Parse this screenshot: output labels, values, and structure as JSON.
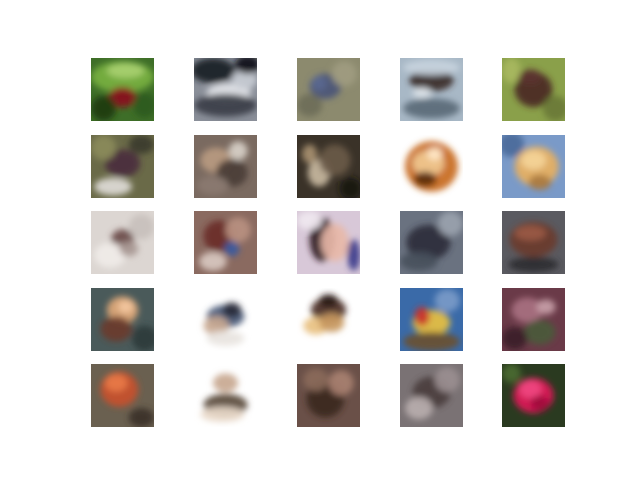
{
  "figure": {
    "background": "#ffffff",
    "rows": 5,
    "cols": 5
  },
  "tiles": [
    {
      "label": "sample-r1-c1",
      "bg": "#3e6e28",
      "blobs": [
        [
          "#78b040",
          0.5,
          0.3,
          0.5,
          0.25
        ],
        [
          "#a8d070",
          0.55,
          0.2,
          0.3,
          0.12
        ],
        [
          "#8a1020",
          0.5,
          0.62,
          0.22,
          0.16
        ],
        [
          "#1e3a12",
          0.2,
          0.8,
          0.2,
          0.2
        ],
        [
          "#2c5a1c",
          0.85,
          0.75,
          0.18,
          0.2
        ]
      ]
    },
    {
      "label": "sample-r1-c2",
      "bg": "#8a8f99",
      "blobs": [
        [
          "#1a1c22",
          0.3,
          0.2,
          0.35,
          0.2
        ],
        [
          "#e4e6ea",
          0.55,
          0.55,
          0.35,
          0.15
        ],
        [
          "#3a3e48",
          0.5,
          0.75,
          0.5,
          0.18
        ],
        [
          "#c8ccd4",
          0.8,
          0.35,
          0.2,
          0.15
        ],
        [
          "#0e1014",
          0.85,
          0.1,
          0.2,
          0.15
        ]
      ]
    },
    {
      "label": "sample-r1-c3",
      "bg": "#8c8a6e",
      "blobs": [
        [
          "#4a5478",
          0.45,
          0.45,
          0.25,
          0.2
        ],
        [
          "#5a6890",
          0.35,
          0.4,
          0.12,
          0.12
        ],
        [
          "#a09c80",
          0.75,
          0.25,
          0.2,
          0.2
        ],
        [
          "#6e6c58",
          0.2,
          0.75,
          0.2,
          0.18
        ]
      ]
    },
    {
      "label": "sample-r1-c4",
      "bg": "#a8b8c6",
      "blobs": [
        [
          "#3a2a28",
          0.5,
          0.35,
          0.35,
          0.18
        ],
        [
          "#c8d4de",
          0.5,
          0.15,
          0.45,
          0.12
        ],
        [
          "#5a6a78",
          0.5,
          0.8,
          0.45,
          0.16
        ],
        [
          "#e0e6ec",
          0.35,
          0.55,
          0.15,
          0.08
        ]
      ]
    },
    {
      "label": "sample-r1-c5",
      "bg": "#8aa04a",
      "blobs": [
        [
          "#4a2824",
          0.5,
          0.5,
          0.3,
          0.28
        ],
        [
          "#a8b860",
          0.15,
          0.2,
          0.15,
          0.2
        ],
        [
          "#6a7a38",
          0.85,
          0.8,
          0.2,
          0.2
        ],
        [
          "#5c3430",
          0.45,
          0.3,
          0.18,
          0.12
        ]
      ]
    },
    {
      "label": "sample-r2-c1",
      "bg": "#6a6a48",
      "blobs": [
        [
          "#4a2c3c",
          0.5,
          0.45,
          0.28,
          0.22
        ],
        [
          "#e0dcd8",
          0.35,
          0.82,
          0.3,
          0.14
        ],
        [
          "#8a8a5a",
          0.2,
          0.2,
          0.2,
          0.2
        ],
        [
          "#3a3a2a",
          0.8,
          0.15,
          0.2,
          0.15
        ]
      ]
    },
    {
      "label": "sample-r2-c2",
      "bg": "#7a6a60",
      "blobs": [
        [
          "#b89a80",
          0.35,
          0.4,
          0.25,
          0.2
        ],
        [
          "#4a3c36",
          0.6,
          0.6,
          0.25,
          0.22
        ],
        [
          "#d8d0c8",
          0.7,
          0.25,
          0.15,
          0.15
        ],
        [
          "#8a7a70",
          0.3,
          0.8,
          0.25,
          0.15
        ]
      ]
    },
    {
      "label": "sample-r2-c3",
      "bg": "#3a3228",
      "blobs": [
        [
          "#c8b8a0",
          0.35,
          0.6,
          0.18,
          0.22
        ],
        [
          "#6a5a48",
          0.6,
          0.4,
          0.25,
          0.25
        ],
        [
          "#1a1612",
          0.85,
          0.85,
          0.18,
          0.18
        ],
        [
          "#a89070",
          0.2,
          0.3,
          0.12,
          0.15
        ]
      ]
    },
    {
      "label": "sample-r2-c4",
      "bg": "#ffffff",
      "blobs": [
        [
          "#c86a20",
          0.5,
          0.5,
          0.42,
          0.4
        ],
        [
          "#f0c890",
          0.45,
          0.45,
          0.25,
          0.2
        ],
        [
          "#5a2c10",
          0.4,
          0.7,
          0.18,
          0.12
        ],
        [
          "#ffe8c8",
          0.55,
          0.3,
          0.12,
          0.1
        ]
      ]
    },
    {
      "label": "sample-r2-c5",
      "bg": "#7a9ac8",
      "blobs": [
        [
          "#e8b060",
          0.55,
          0.5,
          0.35,
          0.32
        ],
        [
          "#f4d498",
          0.5,
          0.4,
          0.2,
          0.15
        ],
        [
          "#4a6a9a",
          0.15,
          0.15,
          0.2,
          0.2
        ],
        [
          "#a87840",
          0.6,
          0.75,
          0.18,
          0.12
        ]
      ]
    },
    {
      "label": "sample-r3-c1",
      "bg": "#dcd6d2",
      "blobs": [
        [
          "#6a4a48",
          0.5,
          0.45,
          0.18,
          0.16
        ],
        [
          "#f0ece8",
          0.3,
          0.7,
          0.25,
          0.2
        ],
        [
          "#a89894",
          0.6,
          0.6,
          0.15,
          0.12
        ],
        [
          "#c8c0bc",
          0.8,
          0.25,
          0.2,
          0.2
        ]
      ]
    },
    {
      "label": "sample-r3-c2",
      "bg": "#8a6a60",
      "blobs": [
        [
          "#6a2c28",
          0.4,
          0.4,
          0.25,
          0.25
        ],
        [
          "#b89080",
          0.7,
          0.3,
          0.2,
          0.2
        ],
        [
          "#3a5aa0",
          0.6,
          0.6,
          0.12,
          0.12
        ],
        [
          "#d8c8c0",
          0.3,
          0.8,
          0.22,
          0.15
        ]
      ]
    },
    {
      "label": "sample-r3-c3",
      "bg": "#d8c8d8",
      "blobs": [
        [
          "#2a1a20",
          0.4,
          0.45,
          0.2,
          0.35
        ],
        [
          "#e8b8a8",
          0.6,
          0.5,
          0.22,
          0.3
        ],
        [
          "#3a3a8a",
          0.9,
          0.7,
          0.1,
          0.25
        ],
        [
          "#f0e8f0",
          0.2,
          0.15,
          0.2,
          0.15
        ]
      ]
    },
    {
      "label": "sample-r3-c4",
      "bg": "#6a7280",
      "blobs": [
        [
          "#2c2e3a",
          0.45,
          0.5,
          0.35,
          0.28
        ],
        [
          "#9aa2ae",
          0.8,
          0.2,
          0.2,
          0.2
        ],
        [
          "#48505c",
          0.3,
          0.8,
          0.3,
          0.15
        ]
      ]
    },
    {
      "label": "sample-r3-c5",
      "bg": "#5a5a60",
      "blobs": [
        [
          "#6a3a2c",
          0.5,
          0.45,
          0.38,
          0.28
        ],
        [
          "#9a5a44",
          0.45,
          0.35,
          0.25,
          0.12
        ],
        [
          "#2c2c30",
          0.5,
          0.85,
          0.4,
          0.12
        ]
      ]
    },
    {
      "label": "sample-r4-c1",
      "bg": "#4a5a5a",
      "blobs": [
        [
          "#e0a878",
          0.5,
          0.35,
          0.25,
          0.22
        ],
        [
          "#6a3a2c",
          0.4,
          0.65,
          0.25,
          0.2
        ],
        [
          "#2a3a3a",
          0.85,
          0.8,
          0.2,
          0.2
        ],
        [
          "#f4c8a0",
          0.55,
          0.3,
          0.12,
          0.1
        ]
      ]
    },
    {
      "label": "sample-r4-c2",
      "bg": "#ffffff",
      "blobs": [
        [
          "#4a5a78",
          0.5,
          0.45,
          0.3,
          0.18
        ],
        [
          "#c8a890",
          0.35,
          0.6,
          0.2,
          0.15
        ],
        [
          "#2a2a3a",
          0.6,
          0.35,
          0.15,
          0.12
        ],
        [
          "#e8e4e0",
          0.5,
          0.8,
          0.3,
          0.12
        ]
      ]
    },
    {
      "label": "sample-r4-c3",
      "bg": "#ffffff",
      "blobs": [
        [
          "#4a2c24",
          0.5,
          0.35,
          0.28,
          0.2
        ],
        [
          "#e8c080",
          0.3,
          0.6,
          0.2,
          0.14
        ],
        [
          "#c89860",
          0.55,
          0.55,
          0.2,
          0.15
        ],
        [
          "#2a1a14",
          0.5,
          0.2,
          0.15,
          0.1
        ]
      ]
    },
    {
      "label": "sample-r4-c4",
      "bg": "#3a6aa8",
      "blobs": [
        [
          "#e8c040",
          0.5,
          0.55,
          0.3,
          0.2
        ],
        [
          "#c8302c",
          0.35,
          0.45,
          0.12,
          0.15
        ],
        [
          "#6a5030",
          0.5,
          0.85,
          0.45,
          0.15
        ],
        [
          "#7a9ac8",
          0.75,
          0.2,
          0.2,
          0.18
        ]
      ]
    },
    {
      "label": "sample-r4-c5",
      "bg": "#6a3a48",
      "blobs": [
        [
          "#a87080",
          0.4,
          0.35,
          0.25,
          0.2
        ],
        [
          "#4a5a3a",
          0.6,
          0.7,
          0.25,
          0.2
        ],
        [
          "#c8a0a8",
          0.7,
          0.3,
          0.15,
          0.12
        ],
        [
          "#3a2028",
          0.2,
          0.8,
          0.2,
          0.18
        ]
      ]
    },
    {
      "label": "sample-r5-c1",
      "bg": "#6a6050",
      "blobs": [
        [
          "#c8502c",
          0.45,
          0.4,
          0.3,
          0.28
        ],
        [
          "#e87848",
          0.4,
          0.3,
          0.18,
          0.14
        ],
        [
          "#3a3028",
          0.8,
          0.85,
          0.2,
          0.15
        ]
      ]
    },
    {
      "label": "sample-r5-c2",
      "bg": "#ffffff",
      "blobs": [
        [
          "#c8a890",
          0.5,
          0.3,
          0.2,
          0.15
        ],
        [
          "#5a4a3a",
          0.5,
          0.65,
          0.35,
          0.18
        ],
        [
          "#e8d8c8",
          0.45,
          0.8,
          0.35,
          0.12
        ]
      ]
    },
    {
      "label": "sample-r5-c3",
      "bg": "#6a5048",
      "blobs": [
        [
          "#3a2620",
          0.45,
          0.55,
          0.3,
          0.3
        ],
        [
          "#a88070",
          0.7,
          0.3,
          0.2,
          0.2
        ],
        [
          "#8a6a5a",
          0.3,
          0.25,
          0.2,
          0.18
        ]
      ]
    },
    {
      "label": "sample-r5-c4",
      "bg": "#7a7274",
      "blobs": [
        [
          "#4a3e3e",
          0.5,
          0.45,
          0.3,
          0.25
        ],
        [
          "#b8aeae",
          0.3,
          0.7,
          0.22,
          0.18
        ],
        [
          "#9a8e90",
          0.75,
          0.25,
          0.2,
          0.2
        ]
      ]
    },
    {
      "label": "sample-r5-c5",
      "bg": "#2a3a20",
      "blobs": [
        [
          "#e01858",
          0.5,
          0.5,
          0.32,
          0.28
        ],
        [
          "#f04880",
          0.45,
          0.4,
          0.18,
          0.15
        ],
        [
          "#a0103c",
          0.6,
          0.62,
          0.15,
          0.12
        ],
        [
          "#4a6a30",
          0.15,
          0.15,
          0.15,
          0.15
        ]
      ]
    }
  ]
}
